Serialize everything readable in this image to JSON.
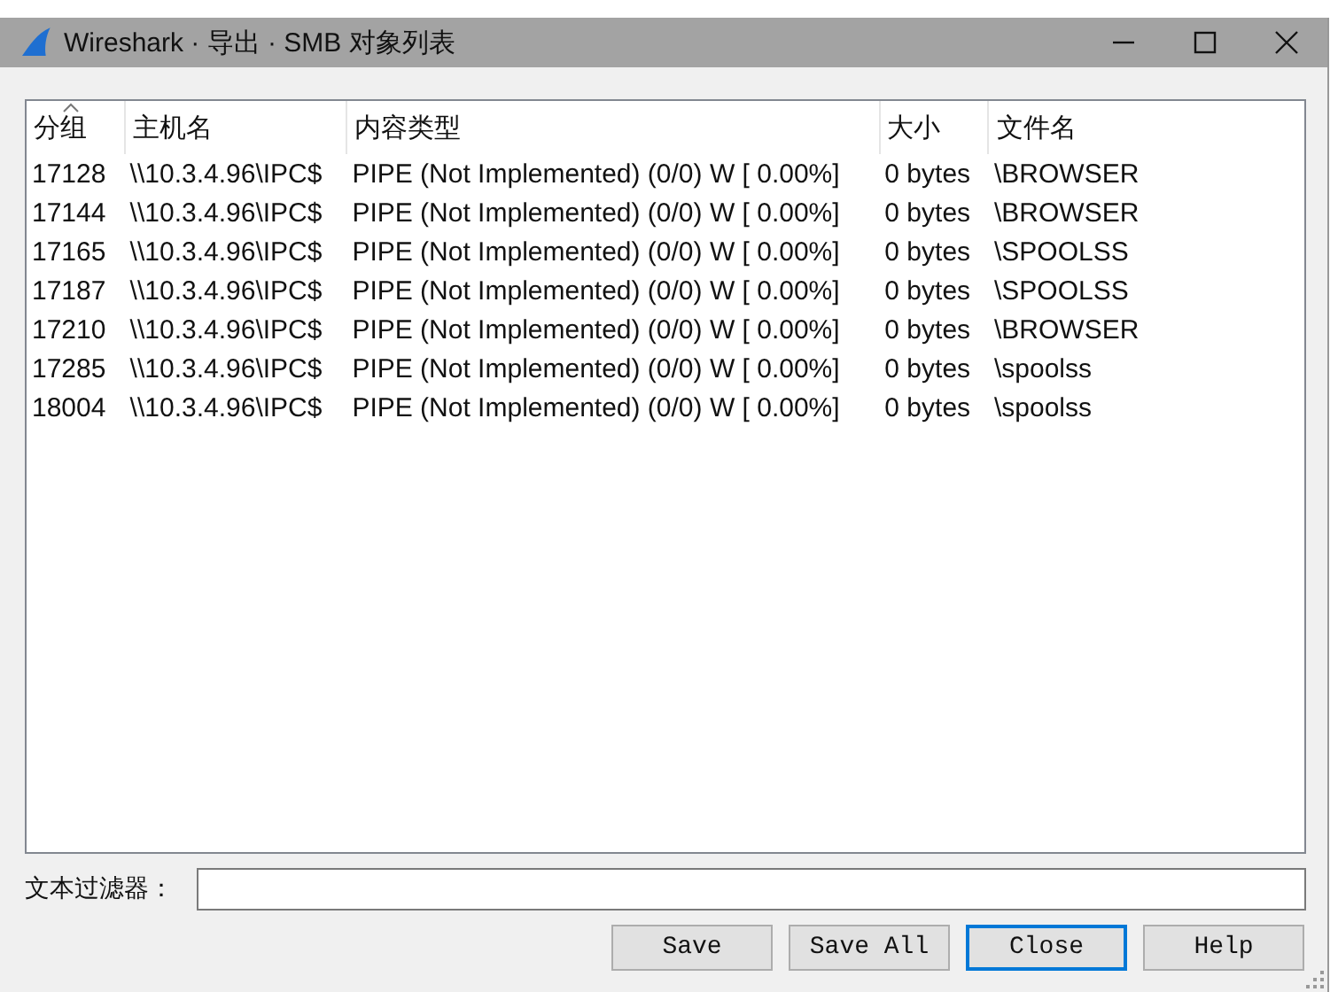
{
  "window": {
    "title": "Wireshark · 导出 · SMB 对象列表"
  },
  "table": {
    "columns": [
      {
        "label": "分组",
        "sorted": true
      },
      {
        "label": "主机名",
        "sorted": false
      },
      {
        "label": "内容类型",
        "sorted": false
      },
      {
        "label": "大小",
        "sorted": false
      },
      {
        "label": "文件名",
        "sorted": false
      }
    ],
    "rows": [
      [
        "17128",
        "\\\\10.3.4.96\\IPC$",
        "PIPE (Not Implemented) (0/0) W [ 0.00%]",
        "0 bytes",
        "\\BROWSER"
      ],
      [
        "17144",
        "\\\\10.3.4.96\\IPC$",
        "PIPE (Not Implemented) (0/0) W [ 0.00%]",
        "0 bytes",
        "\\BROWSER"
      ],
      [
        "17165",
        "\\\\10.3.4.96\\IPC$",
        "PIPE (Not Implemented) (0/0) W [ 0.00%]",
        "0 bytes",
        "\\SPOOLSS"
      ],
      [
        "17187",
        "\\\\10.3.4.96\\IPC$",
        "PIPE (Not Implemented) (0/0) W [ 0.00%]",
        "0 bytes",
        "\\SPOOLSS"
      ],
      [
        "17210",
        "\\\\10.3.4.96\\IPC$",
        "PIPE (Not Implemented) (0/0) W [ 0.00%]",
        "0 bytes",
        "\\BROWSER"
      ],
      [
        "17285",
        "\\\\10.3.4.96\\IPC$",
        "PIPE (Not Implemented) (0/0) W [ 0.00%]",
        "0 bytes",
        "\\spoolss"
      ],
      [
        "18004",
        "\\\\10.3.4.96\\IPC$",
        "PIPE (Not Implemented) (0/0) W [ 0.00%]",
        "0 bytes",
        "\\spoolss"
      ]
    ]
  },
  "filter": {
    "label": "文本过滤器："
  },
  "buttons": [
    {
      "label": "Save",
      "focused": false
    },
    {
      "label": "Save All",
      "focused": false
    },
    {
      "label": "Close",
      "focused": true
    },
    {
      "label": "Help",
      "focused": false
    }
  ]
}
